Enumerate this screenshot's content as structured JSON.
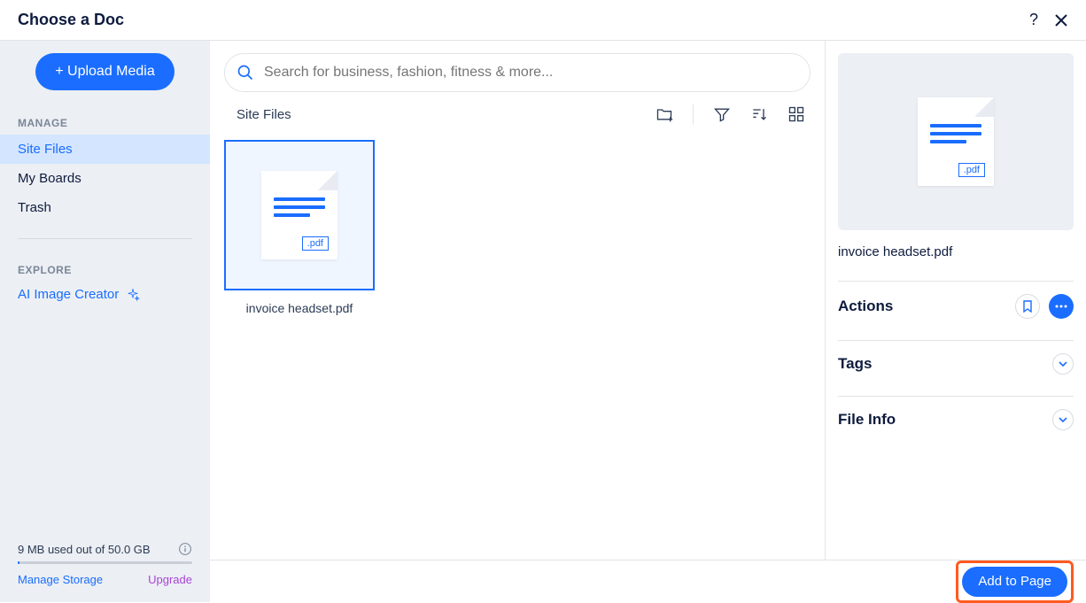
{
  "header": {
    "title": "Choose a Doc"
  },
  "sidebar": {
    "upload_label": "+ Upload Media",
    "manage_label": "MANAGE",
    "nav_items": [
      "Site Files",
      "My Boards",
      "Trash"
    ],
    "explore_label": "EXPLORE",
    "ai_creator_label": "AI Image Creator",
    "storage_text": "9 MB used out of 50.0 GB",
    "manage_storage": "Manage Storage",
    "upgrade": "Upgrade"
  },
  "center": {
    "search_placeholder": "Search for business, fashion, fitness & more...",
    "toolbar_title": "Site Files",
    "files": [
      {
        "name": "invoice headset.pdf",
        "ext": ".pdf"
      }
    ]
  },
  "rightpane": {
    "preview_ext": ".pdf",
    "filename": "invoice headset.pdf",
    "actions_label": "Actions",
    "tags_label": "Tags",
    "fileinfo_label": "File Info"
  },
  "footer": {
    "add_to_page": "Add to Page"
  },
  "colors": {
    "primary": "#1a6dff",
    "highlight": "#ff5a1f"
  }
}
